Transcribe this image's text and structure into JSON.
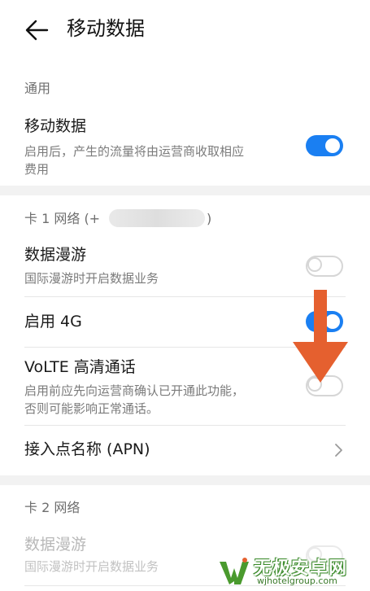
{
  "header": {
    "title": "移动数据"
  },
  "general": {
    "section_label": "通用",
    "mobile_data": {
      "title": "移动数据",
      "subtitle_line1": "启用后，产生的流量将由运营商收取相应",
      "subtitle_line2": "费用",
      "enabled": true
    }
  },
  "sim1": {
    "section_label": "卡 1 网络 (+",
    "section_label_close": ")",
    "roaming": {
      "title": "数据漫游",
      "subtitle": "国际漫游时开启数据业务",
      "enabled": false
    },
    "enable_4g": {
      "title": "启用 4G",
      "enabled": true
    },
    "volte": {
      "title": "VoLTE 高清通话",
      "subtitle_line1": "启用前应先向运营商确认已开通此功能，",
      "subtitle_line2": "否则可能影响正常通话。",
      "enabled": false
    },
    "apn": {
      "title": "接入点名称 (APN)"
    }
  },
  "sim2": {
    "section_label": "卡 2 网络",
    "roaming": {
      "title": "数据漫游",
      "subtitle": "国际漫游时开启数据业务",
      "enabled": false
    }
  },
  "watermark": {
    "name": "无极安卓网",
    "url": "wjhotelgroup.com"
  },
  "colors": {
    "accent": "#1a7ff2",
    "annotation_arrow": "#e5602f"
  }
}
